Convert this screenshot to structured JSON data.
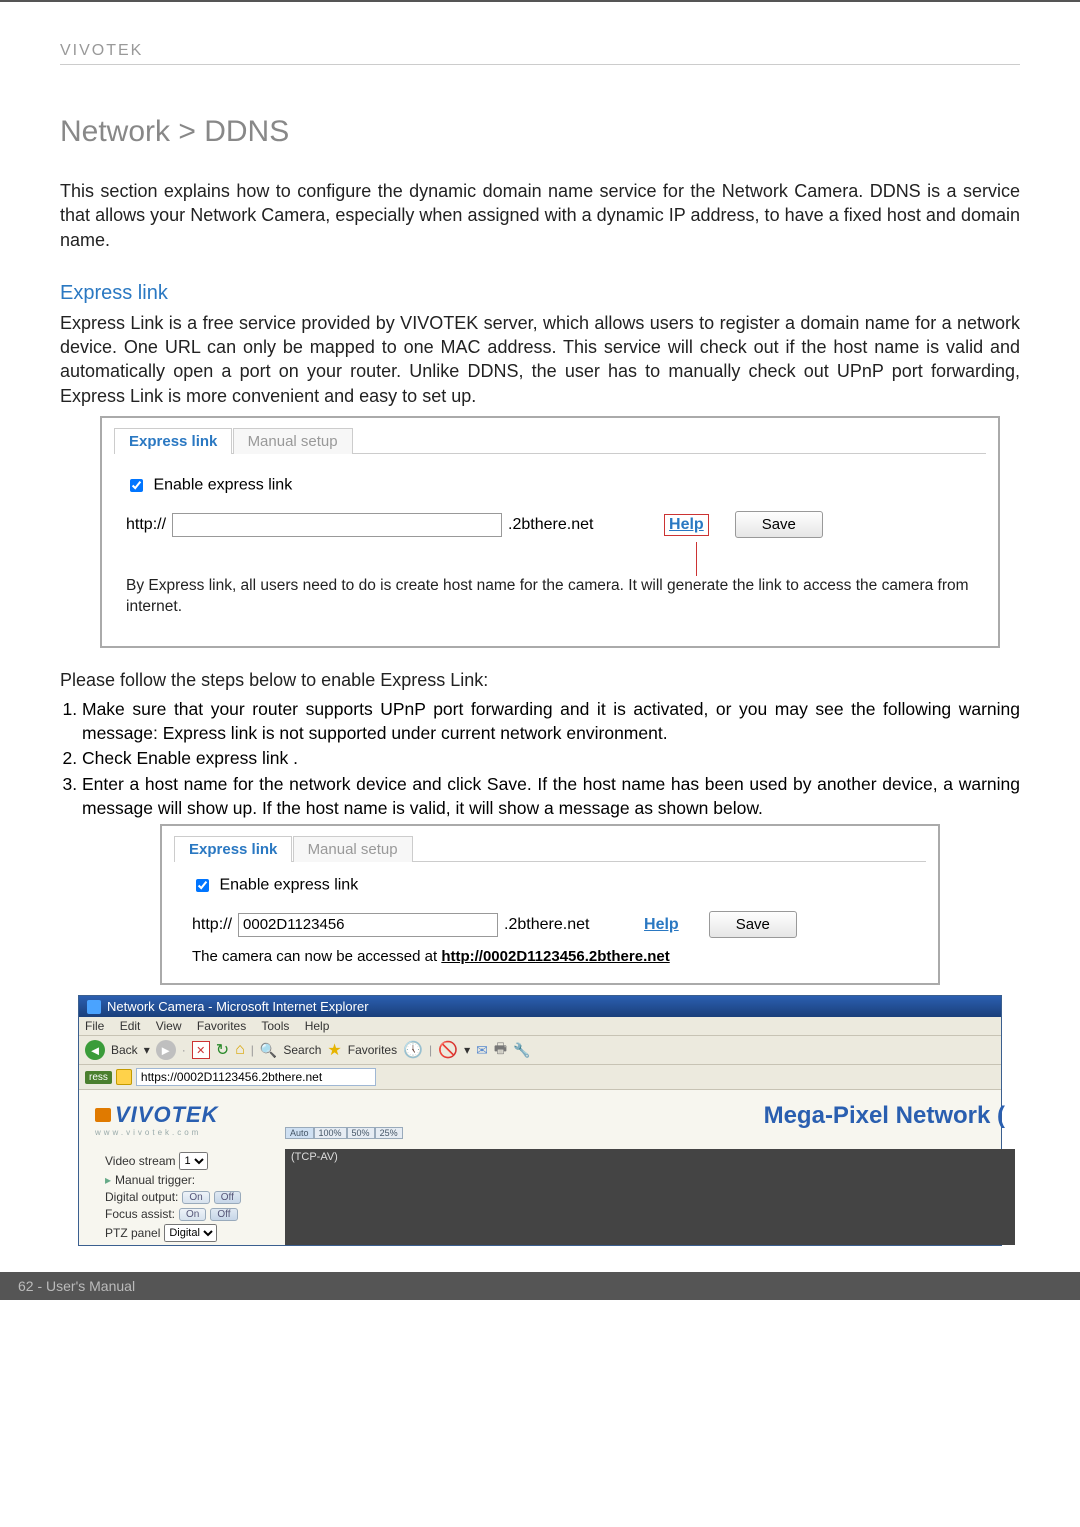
{
  "header": {
    "brand": "VIVOTEK"
  },
  "breadcrumb": "Network > DDNS",
  "intro": "This section explains how to configure the dynamic domain name service for the Network Camera. DDNS is a service that allows your Network Camera, especially when assigned with a dynamic IP address, to have a fixed host and domain name.",
  "express": {
    "heading": "Express link",
    "body": "Express Link is a free service provided by VIVOTEK server, which allows users to register a domain name for a network device. One URL can only be mapped to one MAC address. This service will check out if the host name is valid and automatically open a port on your router. Unlike DDNS, the user has to manually check out UPnP port forwarding, Express Link is more convenient and easy to set up."
  },
  "panel1": {
    "tabs": {
      "active": "Express link",
      "inactive": "Manual setup"
    },
    "enable_label": "Enable express link",
    "enable_checked": true,
    "url_prefix": "http://",
    "host_value": "",
    "url_suffix": ".2bthere.net",
    "help": "Help",
    "save": "Save",
    "note": "By Express link, all users need to do is create host name for the camera. It will generate the link to access the camera from internet."
  },
  "steps_intro": "Please follow the steps below to enable Express Link:",
  "steps": [
    "Make sure that your router supports UPnP port forwarding and it is activated, or you may see the following warning message: Express link is not supported under current network environment.",
    "Check Enable express link   .",
    "Enter a host name for the network device and click Save. If the host name has been used by another device, a warning message will show up. If the host name is valid, it will show a message as shown below."
  ],
  "panel2": {
    "tabs": {
      "active": "Express link",
      "inactive": "Manual setup"
    },
    "enable_label": "Enable express link",
    "enable_checked": true,
    "url_prefix": "http://",
    "host_value": "0002D1123456",
    "url_suffix": ".2bthere.net",
    "help": "Help",
    "save": "Save",
    "access_prefix": "The camera can now be accessed at ",
    "access_url": "http://0002D1123456.2bthere.net"
  },
  "ie": {
    "title": "Network Camera - Microsoft Internet Explorer",
    "menus": [
      "File",
      "Edit",
      "View",
      "Favorites",
      "Tools",
      "Help"
    ],
    "back_label": "Back",
    "search_label": "Search",
    "fav_label": "Favorites",
    "address_tag": "ress",
    "address_value": "https://0002D1123456.2bthere.net",
    "logo_text": "VIVOTEK",
    "logo_sub": "www.vivotek.com",
    "banner_right": "Mega-Pixel Network (",
    "left_rows": {
      "video_stream": "Video stream",
      "video_stream_val": "1",
      "manual_trigger": "Manual trigger:",
      "digital_output": "Digital output:",
      "focus_assist": "Focus assist:",
      "on": "On",
      "off": "Off",
      "ptz_panel": "PTZ panel",
      "ptz_val": "Digital"
    },
    "sizes": [
      "Auto",
      "100%",
      "50%",
      "25%"
    ],
    "codec": "(TCP-AV)"
  },
  "footer": "62 - User's Manual"
}
